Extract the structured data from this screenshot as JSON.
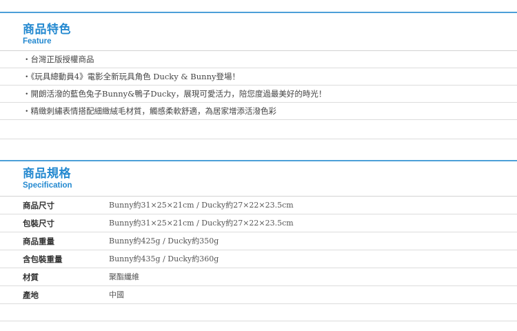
{
  "feature": {
    "title": "商品特色",
    "subtitle": "Feature",
    "items": [
      "‧台灣正版授權商品",
      "‧《玩具總動員4》電影全新玩具角色 Ducky & Bunny登場！",
      "‧開朗活潑的藍色兔子Bunny&鴨子Ducky，展現可愛活力，陪您度過最美好的時光！",
      "‧精緻刺繡表情搭配細緻絨毛材質，觸感柔軟舒適，為居家增添活潑色彩"
    ]
  },
  "specification": {
    "title": "商品規格",
    "subtitle": "Specification",
    "rows": [
      {
        "label": "商品尺寸",
        "value": "Bunny約31×25×21cm / Ducky約27×22×23.5cm"
      },
      {
        "label": "包裝尺寸",
        "value": "Bunny約31×25×21cm / Ducky約27×22×23.5cm"
      },
      {
        "label": "商品重量",
        "value": "Bunny約425g / Ducky約350g"
      },
      {
        "label": "含包裝重量",
        "value": "Bunny約435g / Ducky約360g"
      },
      {
        "label": "材質",
        "value": "聚酯纖維"
      },
      {
        "label": "產地",
        "value": "中國"
      }
    ]
  },
  "colors": {
    "accent": "#2489d0",
    "rule": "#4c9fd8",
    "divider": "#dcdcdc"
  }
}
